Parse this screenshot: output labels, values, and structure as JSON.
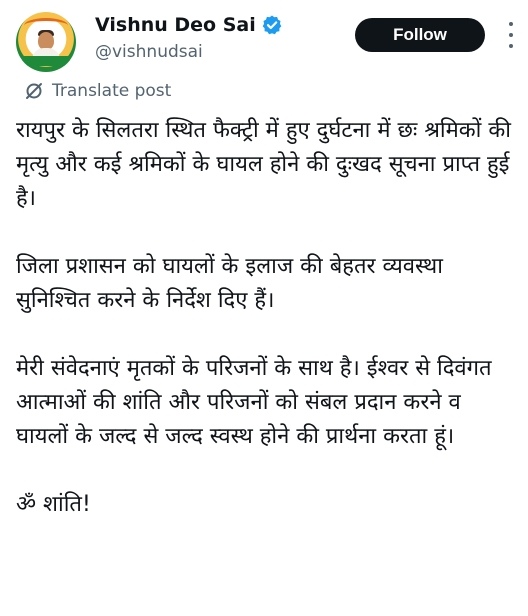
{
  "author": {
    "name": "Vishnu Deo Sai",
    "handle": "@vishnudsai",
    "verified": true,
    "verified_color": "#1d9bf0",
    "avatar_icon": "profile-photo"
  },
  "actions": {
    "follow_label": "Follow",
    "follow_bg": "#0f1419",
    "more_icon": "more-vertical-icon"
  },
  "translate": {
    "label": "Translate post",
    "icon": "translate-slash-icon"
  },
  "post": {
    "paragraphs": [
      "रायपुर के सिलतरा स्थित फैक्ट्री में हुए दुर्घटना में छः श्रमिकों की मृत्यु और कई श्रमिकों के घायल होने की दुःखद सूचना प्राप्त हुई है।",
      "जिला प्रशासन को घायलों के इलाज की बेहतर व्यवस्था सुनिश्चित करने के निर्देश दिए हैं।",
      "मेरी संवेदनाएं मृतकों के परिजनों के साथ है। ईश्वर से दिवंगत आत्माओं की शांति और परिजनों को संबल प्रदान करने व घायलों के जल्द से जल्द स्वस्थ होने की प्रार्थना करता हूं।",
      "ॐ शांति!"
    ]
  }
}
